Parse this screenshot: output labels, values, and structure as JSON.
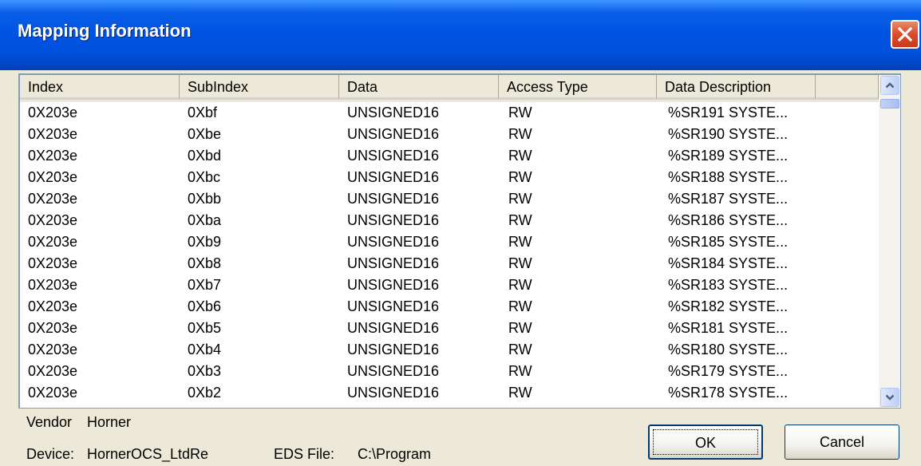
{
  "window": {
    "title": "Mapping Information"
  },
  "columns": [
    "Index",
    "SubIndex",
    "Data",
    "Access Type",
    "Data Description"
  ],
  "rows": [
    [
      "0X203e",
      "0Xbf",
      "UNSIGNED16",
      "RW",
      "%SR191 SYSTE..."
    ],
    [
      "0X203e",
      "0Xbe",
      "UNSIGNED16",
      "RW",
      "%SR190 SYSTE..."
    ],
    [
      "0X203e",
      "0Xbd",
      "UNSIGNED16",
      "RW",
      "%SR189 SYSTE..."
    ],
    [
      "0X203e",
      "0Xbc",
      "UNSIGNED16",
      "RW",
      "%SR188 SYSTE..."
    ],
    [
      "0X203e",
      "0Xbb",
      "UNSIGNED16",
      "RW",
      "%SR187 SYSTE..."
    ],
    [
      "0X203e",
      "0Xba",
      "UNSIGNED16",
      "RW",
      "%SR186 SYSTE..."
    ],
    [
      "0X203e",
      "0Xb9",
      "UNSIGNED16",
      "RW",
      "%SR185 SYSTE..."
    ],
    [
      "0X203e",
      "0Xb8",
      "UNSIGNED16",
      "RW",
      "%SR184 SYSTE..."
    ],
    [
      "0X203e",
      "0Xb7",
      "UNSIGNED16",
      "RW",
      "%SR183 SYSTE..."
    ],
    [
      "0X203e",
      "0Xb6",
      "UNSIGNED16",
      "RW",
      "%SR182 SYSTE..."
    ],
    [
      "0X203e",
      "0Xb5",
      "UNSIGNED16",
      "RW",
      "%SR181 SYSTE..."
    ],
    [
      "0X203e",
      "0Xb4",
      "UNSIGNED16",
      "RW",
      "%SR180 SYSTE..."
    ],
    [
      "0X203e",
      "0Xb3",
      "UNSIGNED16",
      "RW",
      "%SR179 SYSTE..."
    ],
    [
      "0X203e",
      "0Xb2",
      "UNSIGNED16",
      "RW",
      "%SR178 SYSTE..."
    ]
  ],
  "footer": {
    "vendor_label": "Vendor",
    "vendor_value": "Horner",
    "device_label": "Device:",
    "device_value": "HornerOCS_LtdRe",
    "eds_label": "EDS File:",
    "eds_value": "C:\\Program"
  },
  "buttons": {
    "ok": "OK",
    "cancel": "Cancel"
  },
  "icons": {
    "close": "close-icon",
    "scroll_up": "chevron-up-icon",
    "scroll_down": "chevron-down-icon"
  },
  "colors": {
    "titlebar": "#0054e3",
    "close": "#dd4b2b",
    "dialog": "#ece9d8"
  }
}
